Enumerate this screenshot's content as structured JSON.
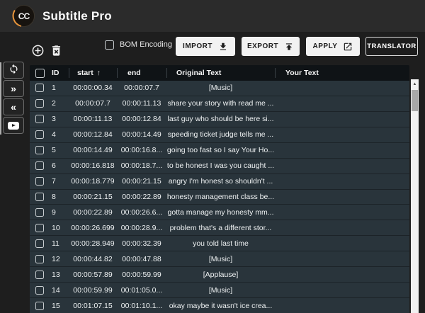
{
  "app": {
    "title": "Subtitle Pro"
  },
  "toolbar": {
    "bom_label": "BOM Encoding",
    "bom_checked": false,
    "import_label": "IMPORT",
    "export_label": "EXPORT",
    "apply_label": "APPLY",
    "translator_label": "TRANSLATOR"
  },
  "icons": {
    "logo": "cc-captions-logo-with-orange-swoosh",
    "add": "plus-circle",
    "delete": "trash-can-with-x",
    "import": "download-arrow-to-bar",
    "export": "upload-arrow-from-bar",
    "apply": "external-link",
    "sidebar": [
      "refresh-sync",
      "double-chevron-right",
      "double-chevron-left",
      "youtube-play"
    ],
    "chevron_right_glyph": "»",
    "chevron_left_glyph": "«",
    "sort_up_glyph": "↑",
    "scroll_up_glyph": "▲",
    "logo_text": "CC"
  },
  "colors": {
    "titlebar_bg": "#2b2b2b",
    "window_bg": "#1e1e1e",
    "table_header_bg": "#0f1316",
    "row_bg": "#29343b",
    "light_button_bg": "#f2f2f2",
    "logo_arc_orange": "#e8953c",
    "scrollbar_track": "#f1f1f1",
    "scrollbar_thumb": "#a8a8a8"
  },
  "table": {
    "headers": {
      "id": "ID",
      "start": "start",
      "end": "end",
      "original": "Original Text",
      "your": "Your Text"
    },
    "sorted_by": "start ascending",
    "rows": [
      {
        "id": "1",
        "start": "00:00:00.34",
        "end": "00:00:07.7",
        "original": "[Music]",
        "your": ""
      },
      {
        "id": "2",
        "start": "00:00:07.7",
        "end": "00:00:11.13",
        "original": "share your story with read me ...",
        "your": ""
      },
      {
        "id": "3",
        "start": "00:00:11.13",
        "end": "00:00:12.84",
        "original": "last guy who should be here si...",
        "your": ""
      },
      {
        "id": "4",
        "start": "00:00:12.84",
        "end": "00:00:14.49",
        "original": "speeding ticket judge tells me ...",
        "your": ""
      },
      {
        "id": "5",
        "start": "00:00:14.49",
        "end": "00:00:16.8...",
        "original": "going too fast so I say Your Ho...",
        "your": ""
      },
      {
        "id": "6",
        "start": "00:00:16.818",
        "end": "00:00:18.7...",
        "original": "to be honest I was you caught ...",
        "your": ""
      },
      {
        "id": "7",
        "start": "00:00:18.779",
        "end": "00:00:21.15",
        "original": "angry I'm honest so shouldn't ...",
        "your": ""
      },
      {
        "id": "8",
        "start": "00:00:21.15",
        "end": "00:00:22.89",
        "original": "honesty management class be...",
        "your": ""
      },
      {
        "id": "9",
        "start": "00:00:22.89",
        "end": "00:00:26.6...",
        "original": "gotta manage my honesty mm...",
        "your": ""
      },
      {
        "id": "10",
        "start": "00:00:26.699",
        "end": "00:00:28.9...",
        "original": "problem that's a different stor...",
        "your": ""
      },
      {
        "id": "11",
        "start": "00:00:28.949",
        "end": "00:00:32.39",
        "original": "you told last time",
        "your": ""
      },
      {
        "id": "12",
        "start": "00:00:44.82",
        "end": "00:00:47.88",
        "original": "[Music]",
        "your": ""
      },
      {
        "id": "13",
        "start": "00:00:57.89",
        "end": "00:00:59.99",
        "original": "[Applause]",
        "your": ""
      },
      {
        "id": "14",
        "start": "00:00:59.99",
        "end": "00:01:05.0...",
        "original": "[Music]",
        "your": ""
      },
      {
        "id": "15",
        "start": "00:01:07.15",
        "end": "00:01:10.1...",
        "original": "okay maybe it wasn't ice crea...",
        "your": ""
      }
    ]
  }
}
